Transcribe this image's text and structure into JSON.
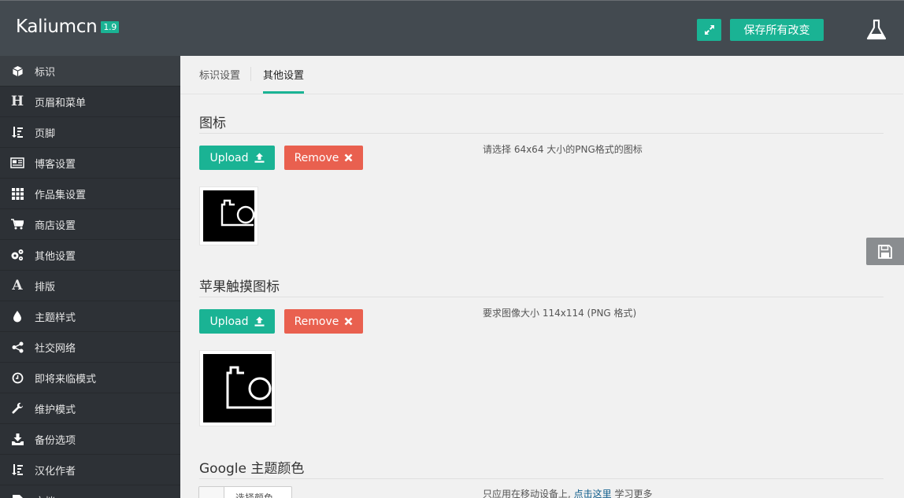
{
  "header": {
    "brand": "Kaliumcn",
    "version": "1.9",
    "save_all_label": "保存所有改变"
  },
  "sidebar": {
    "items": [
      {
        "label": "标识",
        "icon": "cube-icon"
      },
      {
        "label": "页眉和菜单",
        "icon": "header-icon"
      },
      {
        "label": "页脚",
        "icon": "sort-down-icon"
      },
      {
        "label": "博客设置",
        "icon": "newspaper-icon"
      },
      {
        "label": "作品集设置",
        "icon": "grid-icon"
      },
      {
        "label": "商店设置",
        "icon": "cart-icon"
      },
      {
        "label": "其他设置",
        "icon": "gears-icon"
      },
      {
        "label": "排版",
        "icon": "font-icon"
      },
      {
        "label": "主题样式",
        "icon": "drop-icon"
      },
      {
        "label": "社交网络",
        "icon": "share-icon"
      },
      {
        "label": "即将来临模式",
        "icon": "clock-icon"
      },
      {
        "label": "维护模式",
        "icon": "wrench-icon"
      },
      {
        "label": "备份选项",
        "icon": "download-icon"
      },
      {
        "label": "汉化作者",
        "icon": "sort-down-icon"
      },
      {
        "label": "文档",
        "icon": "doc-icon"
      }
    ]
  },
  "tabs": [
    {
      "label": "标识设置"
    },
    {
      "label": "其他设置"
    }
  ],
  "sections": {
    "favicon": {
      "title": "图标",
      "upload_label": "Upload",
      "remove_label": "Remove",
      "hint": "请选择 64x64 大小的PNG格式的图标"
    },
    "apple": {
      "title": "苹果触摸图标",
      "upload_label": "Upload",
      "remove_label": "Remove",
      "hint": "要求图像大小 114x114 (PNG 格式)"
    },
    "google": {
      "title": "Google 主题颜色",
      "color_button_label": "选择颜色",
      "hint_before": "只应用在移动设备上, ",
      "hint_link": "点击这里",
      "hint_after": " 学习更多"
    }
  },
  "colors": {
    "accent": "#1ab394",
    "danger": "#e9604f",
    "topbar": "#434a50",
    "sidebar": "#2d3136"
  }
}
